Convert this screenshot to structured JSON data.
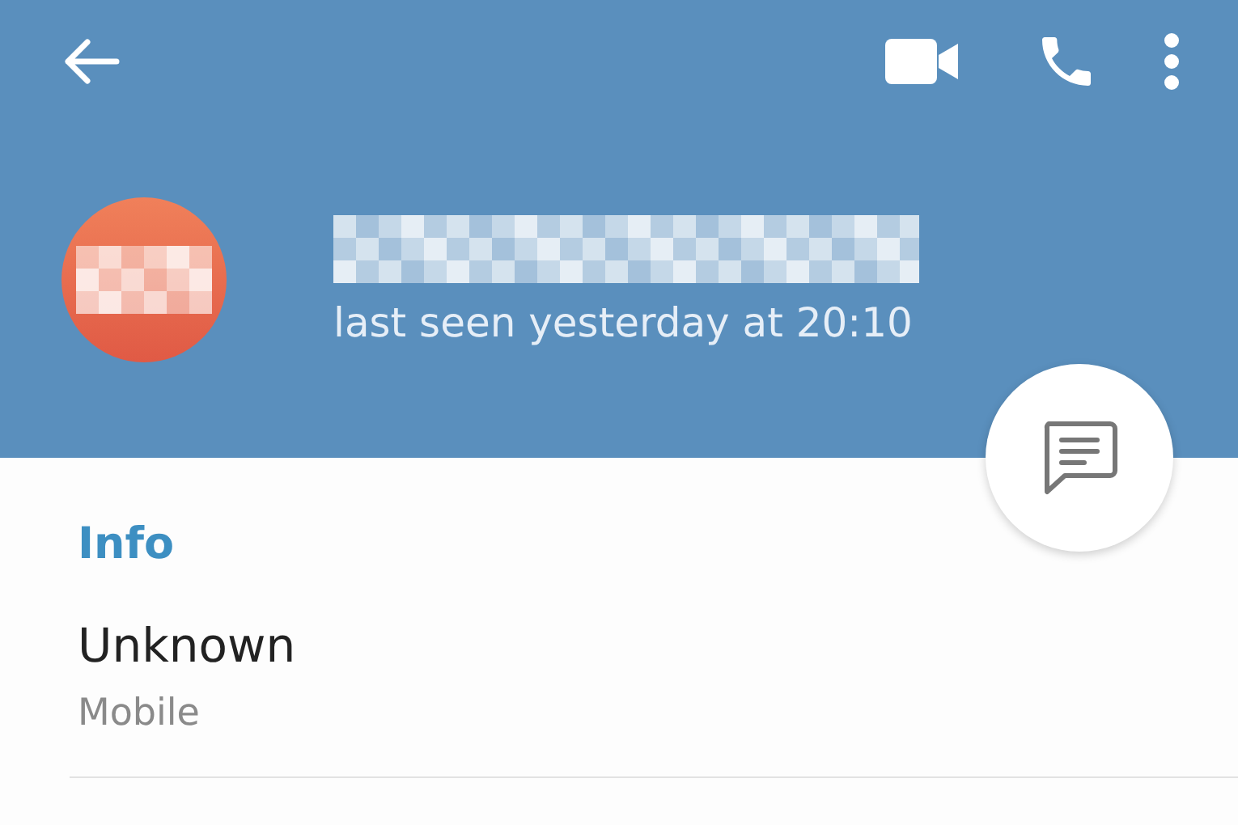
{
  "profile": {
    "status": "last seen yesterday at 20:10"
  },
  "info": {
    "heading": "Info",
    "rows": [
      {
        "value": "Unknown",
        "label": "Mobile"
      }
    ]
  }
}
